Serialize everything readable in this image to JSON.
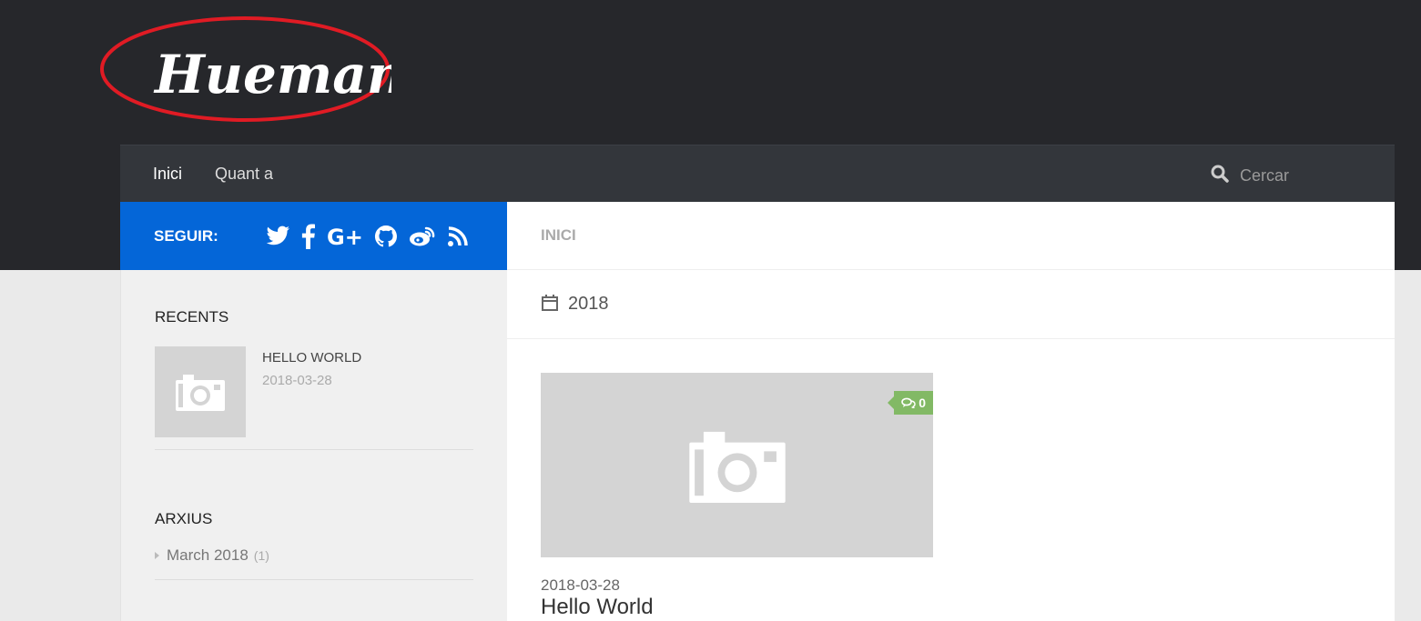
{
  "site": {
    "logo_text": "Hueman"
  },
  "nav": {
    "items": [
      {
        "label": "Inici"
      },
      {
        "label": "Quant a"
      }
    ],
    "search_placeholder": "Cercar"
  },
  "follow": {
    "label": "SEGUIR:",
    "icons": [
      "twitter-icon",
      "facebook-icon",
      "google-plus-icon",
      "github-icon",
      "weibo-icon",
      "rss-icon"
    ]
  },
  "sidebar": {
    "recents_title": "RECENTS",
    "recent_posts": [
      {
        "title": "HELLO WORLD",
        "date": "2018-03-28"
      }
    ],
    "archives_title": "ARXIUS",
    "archives": [
      {
        "label": "March 2018",
        "count": "(1)"
      }
    ]
  },
  "main": {
    "page_title": "INICI",
    "archive_year": "2018",
    "posts": [
      {
        "comments": "0",
        "date": "2018-03-28",
        "title": "Hello World"
      }
    ]
  },
  "colors": {
    "header": "#26272b",
    "nav": "#33363b",
    "follow_bar": "#0466d8",
    "comments_badge": "#82b965",
    "logo_highlight": "#e01b24"
  }
}
